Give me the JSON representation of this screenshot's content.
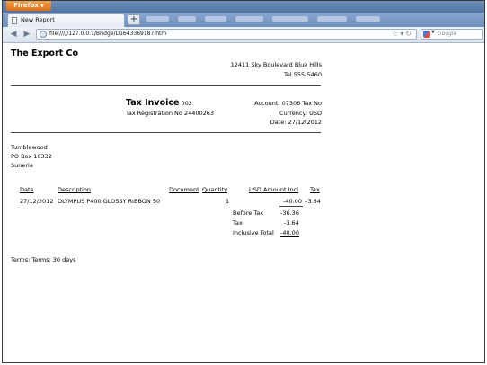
{
  "browser": {
    "app_button_label": "Firefox",
    "tab_title": "New Report",
    "newtab_label": "+",
    "url": "file://///127.0.0.1/Bridge/D1643369187.htm",
    "search_placeholder": "Google"
  },
  "invoice": {
    "company_name": "The Export Co",
    "address_line1": "12411 Sky Boulevard Blue Hills",
    "phone": "Tel 555-5460",
    "title": "Tax Invoice",
    "number": "002",
    "tax_registration": "Tax Registration No 24400263",
    "account": "Account: 07306 Tax No",
    "currency": "Currency: USD",
    "date": "Date: 27/12/2012",
    "customer": {
      "name": "Tumblewood",
      "address1": "PO Box 10332",
      "address2": "Suneria"
    },
    "table": {
      "headers": {
        "date": "Date",
        "description": "Description",
        "document": "Document",
        "quantity": "Quantity",
        "usd_amount": "USD Amount Incl",
        "tax": "Tax"
      },
      "rows": [
        {
          "date": "27/12/2012",
          "description": "OLYMPUS P400 GLOSSY RIBBON 50",
          "document": "",
          "quantity": "1",
          "amount": "-40.00",
          "tax": "-3.64"
        }
      ]
    },
    "totals": {
      "before_tax_label": "Before Tax",
      "before_tax_value": "-36.36",
      "tax_label": "Tax",
      "tax_value": "-3.64",
      "inclusive_label": "Inclusive Total",
      "inclusive_value": "-40.00"
    },
    "terms": "Terms: Terms: 30 days"
  }
}
